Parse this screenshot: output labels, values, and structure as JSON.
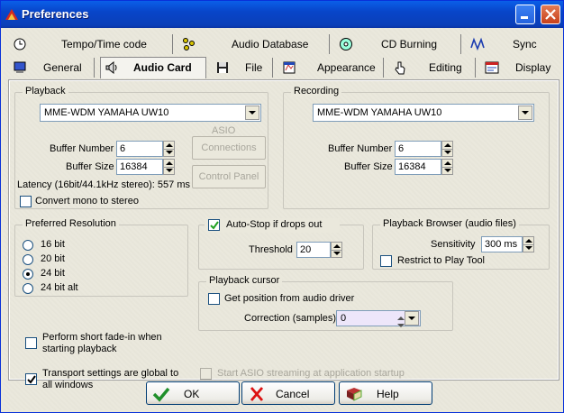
{
  "window": {
    "title": "Preferences"
  },
  "tabs": {
    "row1": [
      {
        "label": "Tempo/Time code",
        "icon": "clock-icon"
      },
      {
        "label": "Audio Database",
        "icon": "database-icon"
      },
      {
        "label": "CD Burning",
        "icon": "cd-icon"
      },
      {
        "label": "Sync",
        "icon": "sync-wave-icon"
      }
    ],
    "row2": [
      {
        "label": "General",
        "icon": "monitor-icon"
      },
      {
        "label": "Audio Card",
        "icon": "speaker-icon",
        "active": true
      },
      {
        "label": "File",
        "icon": "floppy-icon"
      },
      {
        "label": "Appearance",
        "icon": "appearance-icon"
      },
      {
        "label": "Editing",
        "icon": "hand-pointer-icon"
      },
      {
        "label": "Display",
        "icon": "display-icon"
      }
    ]
  },
  "playback": {
    "title": "Playback",
    "device": "MME-WDM YAMAHA UW10",
    "asio_label": "ASIO",
    "buffer_number_label": "Buffer Number",
    "buffer_number": "6",
    "buffer_size_label": "Buffer Size",
    "buffer_size": "16384",
    "connections_label": "Connections",
    "control_panel_label": "Control Panel",
    "latency": "Latency (16bit/44.1kHz stereo): 557 ms",
    "convert_mono_label": "Convert mono to stereo"
  },
  "recording": {
    "title": "Recording",
    "device": "MME-WDM YAMAHA UW10",
    "buffer_number_label": "Buffer Number",
    "buffer_number": "6",
    "buffer_size_label": "Buffer Size",
    "buffer_size": "16384"
  },
  "resolution": {
    "title": "Preferred Resolution",
    "options": [
      "16 bit",
      "20 bit",
      "24 bit",
      "24 bit alt"
    ],
    "selected": "24 bit"
  },
  "autostop": {
    "label": "Auto-Stop if drops out",
    "checked": true,
    "threshold_label": "Threshold",
    "threshold": "20"
  },
  "browser": {
    "title": "Playback Browser (audio files)",
    "sensitivity_label": "Sensitivity",
    "sensitivity": "300 ms",
    "restrict_label": "Restrict to Play Tool"
  },
  "cursor": {
    "title": "Playback cursor",
    "get_position_label": "Get position from audio driver",
    "correction_label": "Correction (samples)",
    "correction": "0"
  },
  "options": {
    "fade_in_line1": "Perform short fade-in when",
    "fade_in_line2": "starting playback",
    "transport_line1": "Transport settings are global to",
    "transport_line2": "all windows",
    "transport_checked": true,
    "asio_streaming": "Start ASIO streaming at application startup"
  },
  "buttons": {
    "ok": "OK",
    "cancel": "Cancel",
    "help": "Help"
  },
  "colors": {
    "title_bar": "#0A3FB8",
    "panel_bg": "#EAE8DC",
    "input_border": "#7F9DB9"
  }
}
